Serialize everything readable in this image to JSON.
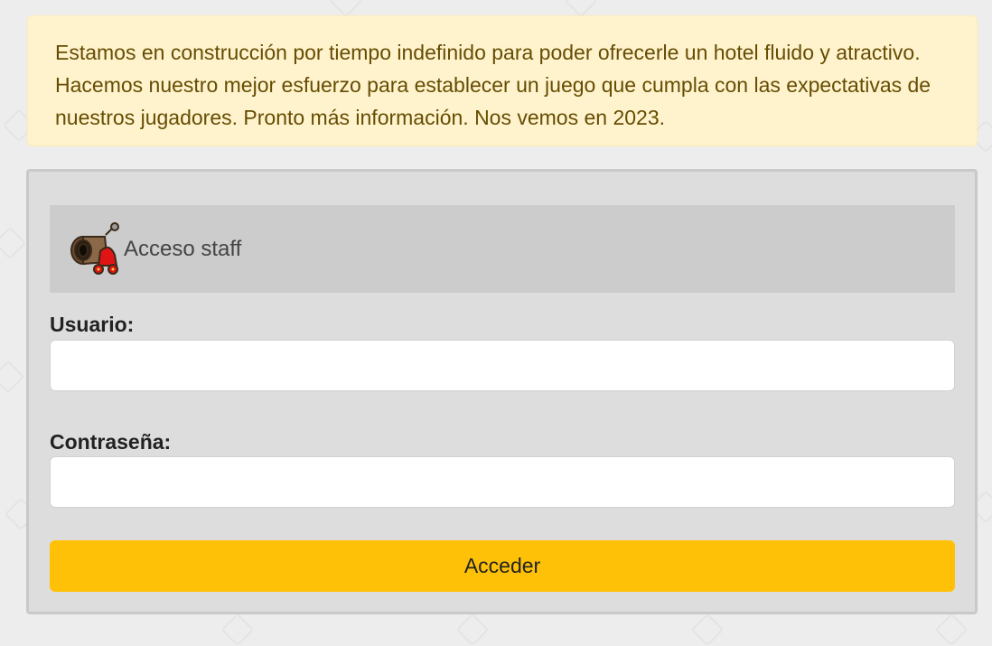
{
  "alert": {
    "message": "Estamos en construcción por tiempo indefinido para poder ofrecerle un hotel fluido y atractivo. Hacemos nuestro mejor esfuerzo para establecer un juego que cumpla con las expectativas de nuestros jugadores. Pronto más información. Nos vemos en 2023."
  },
  "login": {
    "header_title": "Acceso staff",
    "header_icon": "cannon-icon",
    "username_label": "Usuario:",
    "username_value": "",
    "password_label": "Contraseña:",
    "password_value": "",
    "submit_label": "Acceder"
  },
  "colors": {
    "alert_bg": "#fff3cd",
    "alert_text": "#664d03",
    "button": "#ffc107",
    "card_bg": "#dddddd",
    "header_bg": "#cccccc"
  }
}
